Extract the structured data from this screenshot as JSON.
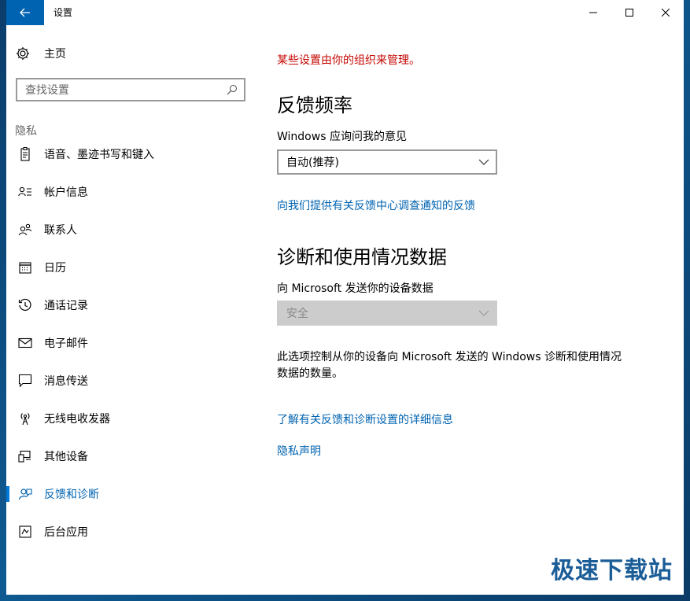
{
  "window": {
    "title": "设置"
  },
  "sidebar": {
    "home_label": "主页",
    "search_placeholder": "查找设置",
    "section_title": "隐私",
    "items": [
      {
        "label": "语音、墨迹书写和键入",
        "icon": "speech-inking-icon"
      },
      {
        "label": "帐户信息",
        "icon": "account-info-icon"
      },
      {
        "label": "联系人",
        "icon": "contacts-icon"
      },
      {
        "label": "日历",
        "icon": "calendar-icon"
      },
      {
        "label": "通话记录",
        "icon": "call-history-icon"
      },
      {
        "label": "电子邮件",
        "icon": "email-icon"
      },
      {
        "label": "消息传送",
        "icon": "messaging-icon"
      },
      {
        "label": "无线电收发器",
        "icon": "radios-icon"
      },
      {
        "label": "其他设备",
        "icon": "other-devices-icon"
      },
      {
        "label": "反馈和诊断",
        "icon": "feedback-icon",
        "active": true
      },
      {
        "label": "后台应用",
        "icon": "background-apps-icon"
      }
    ]
  },
  "content": {
    "managed_notice": "某些设置由你的组织来管理。",
    "feedback": {
      "heading": "反馈频率",
      "label": "Windows 应询问我的意见",
      "selected": "自动(推荐)",
      "link": "向我们提供有关反馈中心调查通知的反馈"
    },
    "diagnostics": {
      "heading": "诊断和使用情况数据",
      "label": "向 Microsoft 发送你的设备数据",
      "selected": "安全",
      "description": "此选项控制从你的设备向 Microsoft 发送的 Windows 诊断和使用情况数据的数量。",
      "learn_more_link": "了解有关反馈和诊断设置的详细信息",
      "privacy_link": "隐私声明"
    }
  },
  "watermark": "极速下载站",
  "colors": {
    "accent": "#0063b1",
    "warning": "#c50500"
  }
}
